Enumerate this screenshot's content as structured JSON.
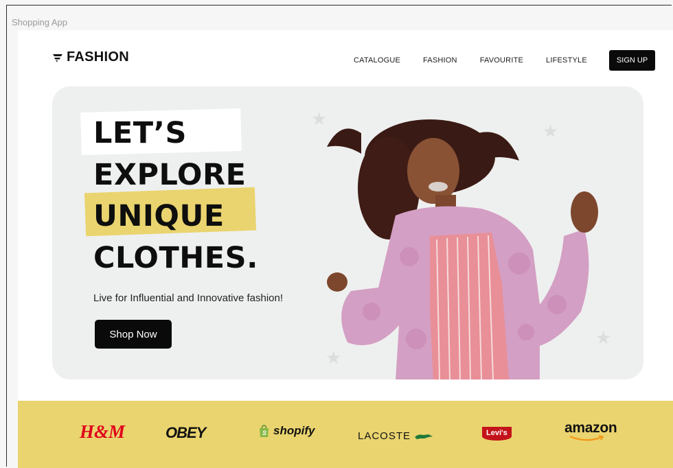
{
  "window": {
    "title": "Shopping App"
  },
  "header": {
    "logo_text": "FASHION",
    "nav": [
      {
        "label": "CATALOGUE"
      },
      {
        "label": "FASHION"
      },
      {
        "label": "FAVOURITE"
      },
      {
        "label": "LIFESTYLE"
      }
    ],
    "signup_label": "SIGN UP"
  },
  "hero": {
    "headline": [
      "LET’S",
      "EXPLORE",
      "UNIQUE",
      "CLOTHES."
    ],
    "subtitle": "Live for Influential and Innovative fashion!",
    "cta_label": "Shop Now"
  },
  "brands": [
    {
      "name": "H&M",
      "color": "#e0001b"
    },
    {
      "name": "OBEY",
      "color": "#111111"
    },
    {
      "name": "shopify",
      "color": "#111111"
    },
    {
      "name": "LACOSTE",
      "color": "#111111"
    },
    {
      "name": "Levi's",
      "color": "#c4121a"
    },
    {
      "name": "amazon",
      "color": "#111111"
    }
  ],
  "colors": {
    "accent_yellow": "#ead46f",
    "dark": "#0a0a0a",
    "hero_bg": "#eef0ef"
  }
}
